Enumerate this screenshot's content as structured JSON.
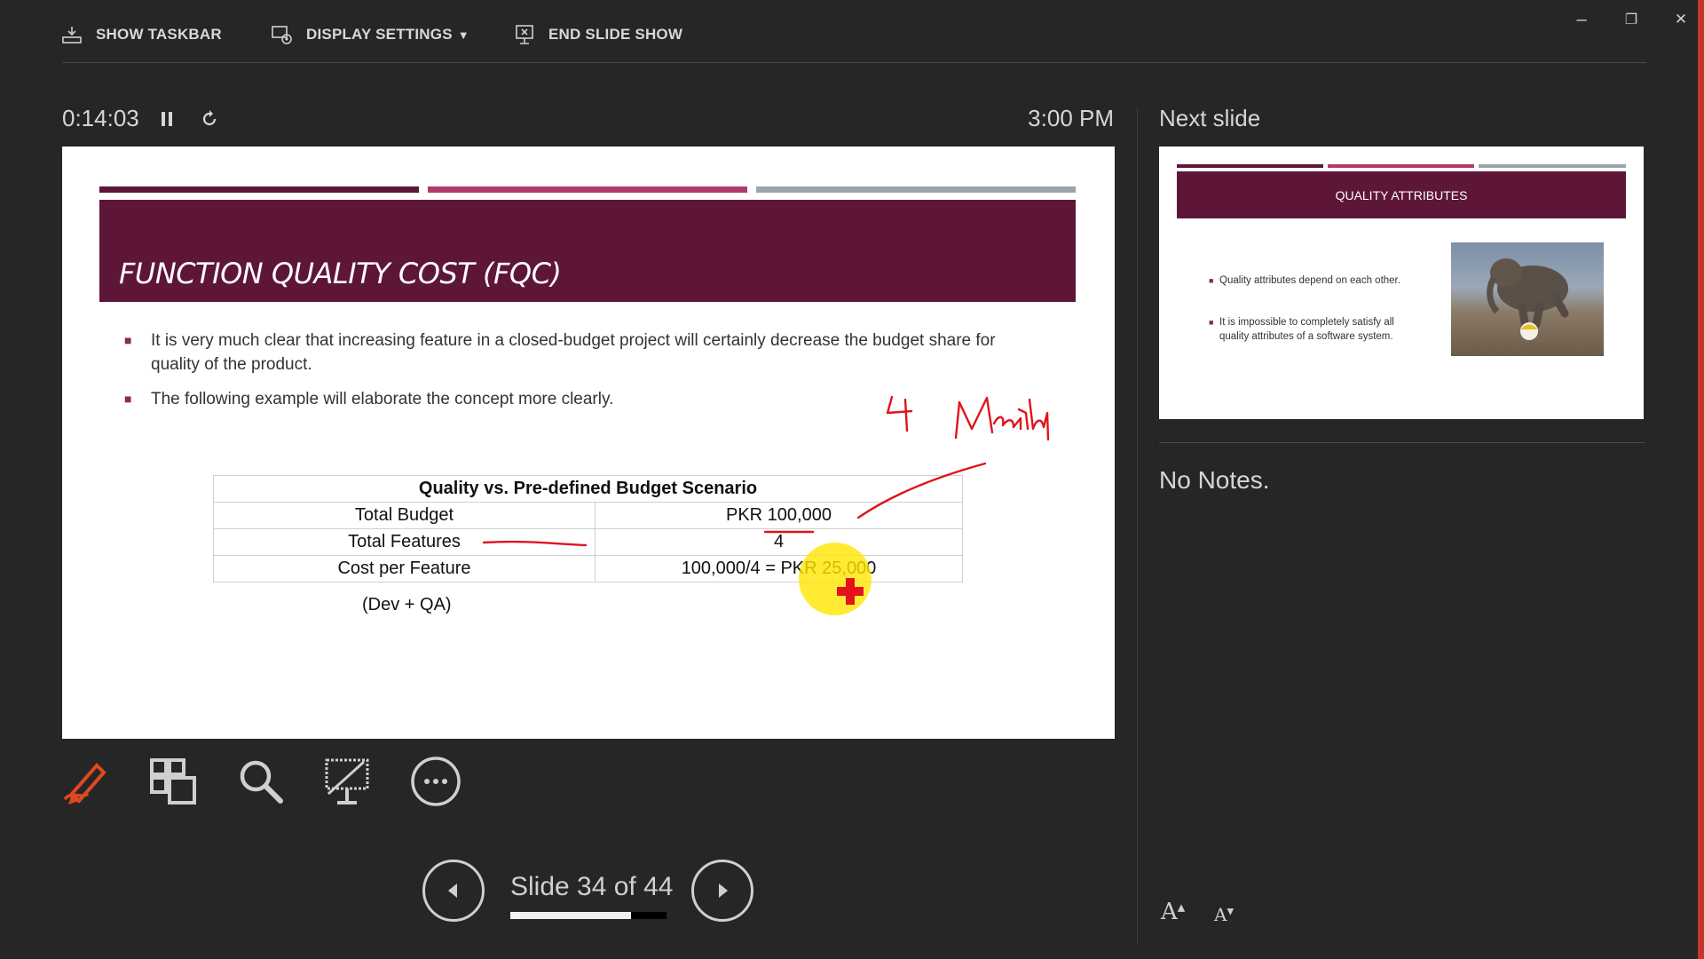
{
  "toolbar": {
    "show_taskbar": "SHOW TASKBAR",
    "display_settings": "DISPLAY SETTINGS",
    "display_settings_caret": "▼",
    "end_slide_show": "END SLIDE SHOW"
  },
  "window_controls": {
    "minimize": "–",
    "restore": "❐",
    "close": "✕"
  },
  "presenter": {
    "elapsed": "0:14:03",
    "clock": "3:00 PM",
    "slide_counter": "Slide 34 of 44",
    "progress_fraction": 0.773
  },
  "current_slide": {
    "title": "FUNCTION QUALITY COST (FQC)",
    "bullets": [
      "It is very much clear that increasing feature in a closed-budget project will certainly decrease the budget share for quality of the product.",
      "The following example will elaborate the concept more clearly."
    ],
    "table": {
      "header": "Quality vs. Pre-defined Budget Scenario",
      "rows": [
        [
          "Total Budget",
          "PKR 100,000"
        ],
        [
          "Total Features",
          "4"
        ],
        [
          "Cost per Feature",
          "100,000/4 = PKR 25,000"
        ]
      ]
    },
    "footnote": "(Dev + QA)",
    "band_colors": [
      "#5e1638",
      "#b03a6b",
      "#9aa4ae"
    ],
    "ink_color": "#e0141e",
    "highlighter_color": "#ffe600"
  },
  "next_slide": {
    "label": "Next slide",
    "title": "QUALITY ATTRIBUTES",
    "bullets": [
      "Quality attributes depend on each other.",
      "It is impossible to completely satisfy all quality attributes of a software system."
    ]
  },
  "notes": {
    "text": "No Notes."
  },
  "tools": [
    "pen-icon",
    "see-all-slides-icon",
    "zoom-icon",
    "black-screen-icon",
    "more-options-icon"
  ],
  "font_controls": {
    "increase": "A",
    "decrease": "A"
  },
  "accent_color": "#e0481f"
}
